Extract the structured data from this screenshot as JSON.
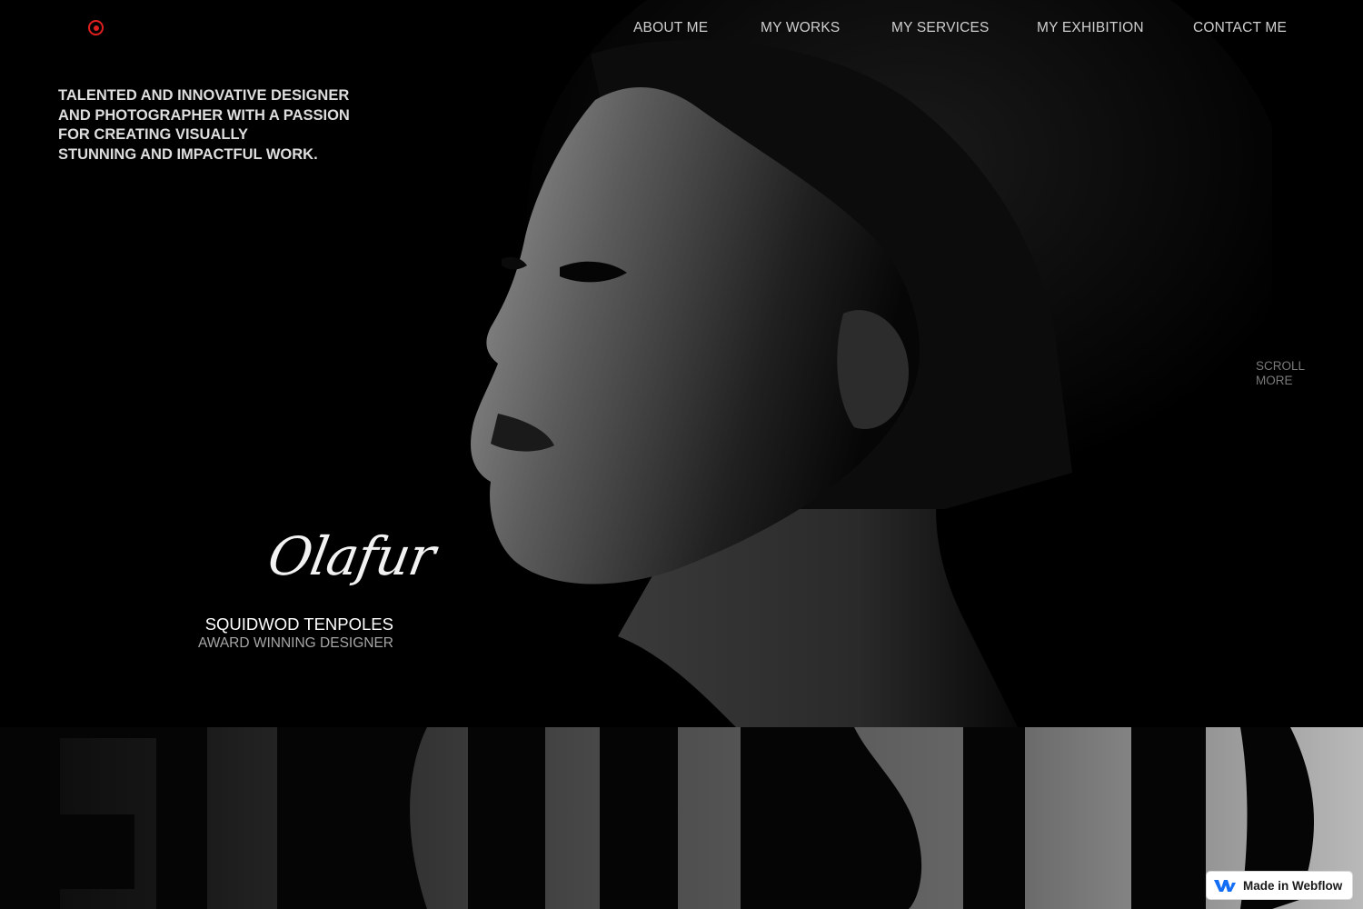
{
  "nav": {
    "items": [
      "ABOUT ME",
      "MY WORKS",
      "MY SERVICES",
      "MY EXHIBITION",
      "CONTACT ME"
    ]
  },
  "hero": {
    "tagline_lines": [
      "TALENTED AND INNOVATIVE DESIGNER",
      "AND PHOTOGRAPHER WITH A PASSION",
      "FOR CREATING VISUALLY",
      "STUNNING AND IMPACTFUL WORK."
    ],
    "signature": "Olafur",
    "name": "SQUIDWOD TENPOLES",
    "role": "AWARD WINNING DESIGNER",
    "scroll_lines": [
      "SCROLL",
      "MORE"
    ]
  },
  "badge": {
    "label": "Made in Webflow"
  },
  "colors": {
    "accent": "#e01f1f",
    "background": "#000000",
    "webflow_blue": "#146ef5"
  },
  "icons": {
    "logo": "target-icon",
    "badge": "webflow-icon"
  }
}
